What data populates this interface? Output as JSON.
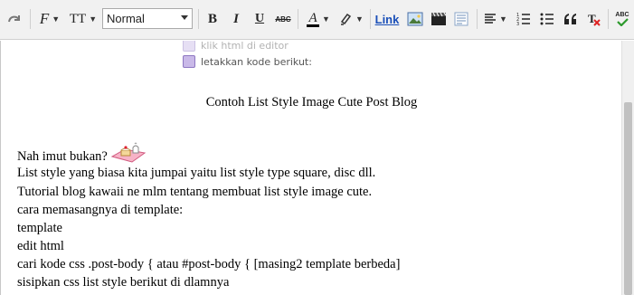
{
  "toolbar": {
    "style_select_value": "Normal",
    "link_label": "Link",
    "icons": [
      "redo-icon",
      "font-family-icon",
      "font-size-icon",
      "bold-icon",
      "italic-icon",
      "underline-icon",
      "strikethrough-icon",
      "text-color-icon",
      "highlight-icon",
      "link",
      "image-icon",
      "video-icon",
      "jump-break-icon",
      "align-icon",
      "numbered-list-icon",
      "bullet-list-icon",
      "blockquote-icon",
      "clear-format-icon",
      "spellcheck-icon"
    ],
    "glyphs": {
      "bold": "B",
      "italic": "I",
      "underline": "U",
      "strike": "ABC",
      "text_color": "A",
      "font_family": "F",
      "font_size": "TT",
      "spell": "ABC"
    }
  },
  "editor": {
    "faded_line_1": "klik html di editor",
    "faded_line_2": "letakkan kode berikut:",
    "title": "Contoh List Style Image Cute Post Blog",
    "lines": [
      "Nah imut bukan?",
      "List style yang biasa kita jumpai yaitu list style type square, disc dll.",
      "Tutorial blog kawaii ne mlm tentang membuat list style image cute.",
      "cara memasangnya di template:",
      "template",
      "edit html",
      "cari kode css .post-body { atau #post-body { [masing2 template berbeda]",
      "sisipkan css list style berikut di dlamnya"
    ]
  },
  "colors": {
    "toolbar_bg": "#f1f1f1",
    "link_blue": "#1a4fb8",
    "spell_underline": "#e02020"
  }
}
